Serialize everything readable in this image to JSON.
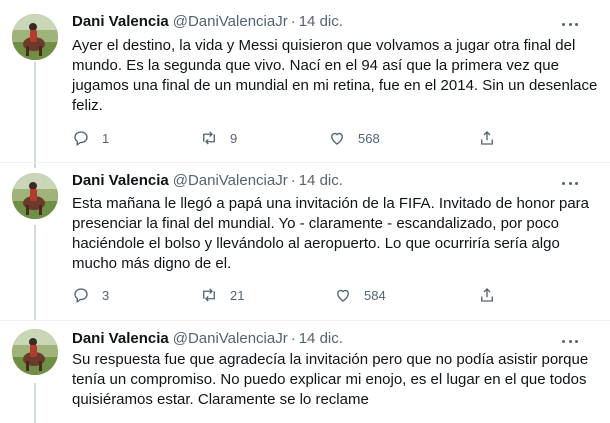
{
  "tweets": [
    {
      "display_name": "Dani Valencia",
      "handle": "@DaniValenciaJr",
      "separator": "·",
      "date": "14 dic.",
      "avatar_icon": "user-avatar-photo",
      "more_icon": "more-options-icon",
      "text": "Ayer el destino, la vida y Messi quisieron que volvamos a jugar otra final del mundo. Es la segunda que vivo. Nací en el 94 así que la primera vez que jugamos una final de un mundial en mi retina, fue en el 2014. Sin un desenlace feliz.",
      "replies": "1",
      "retweets": "9",
      "likes": "568"
    },
    {
      "display_name": "Dani Valencia",
      "handle": "@DaniValenciaJr",
      "separator": "·",
      "date": "14 dic.",
      "avatar_icon": "user-avatar-photo",
      "more_icon": "more-options-icon",
      "text": "Esta mañana le llegó a papá una invitación de la FIFA. Invitado de honor para presenciar la final del mundial. Yo - claramente - escandalizado, por poco haciéndole el bolso y llevándolo al aeropuerto. Lo que ocurriría sería algo mucho más digno de el.",
      "replies": "3",
      "retweets": "21",
      "likes": "584"
    },
    {
      "display_name": "Dani Valencia",
      "handle": "@DaniValenciaJr",
      "separator": "·",
      "date": "14 dic.",
      "avatar_icon": "user-avatar-photo",
      "more_icon": "more-options-icon",
      "text": "Su respuesta fue que agradecía la invitación pero que no podía asistir porque tenía un compromiso. No puedo explicar mi enojo, es el lugar en el que todos quisiéramos estar. Claramente se lo reclame",
      "replies": "",
      "retweets": "",
      "likes": ""
    }
  ],
  "colors": {
    "text_primary": "#0f1419",
    "text_secondary": "#536471",
    "thread_line": "#cfd9de",
    "divider": "#eff3f4"
  }
}
